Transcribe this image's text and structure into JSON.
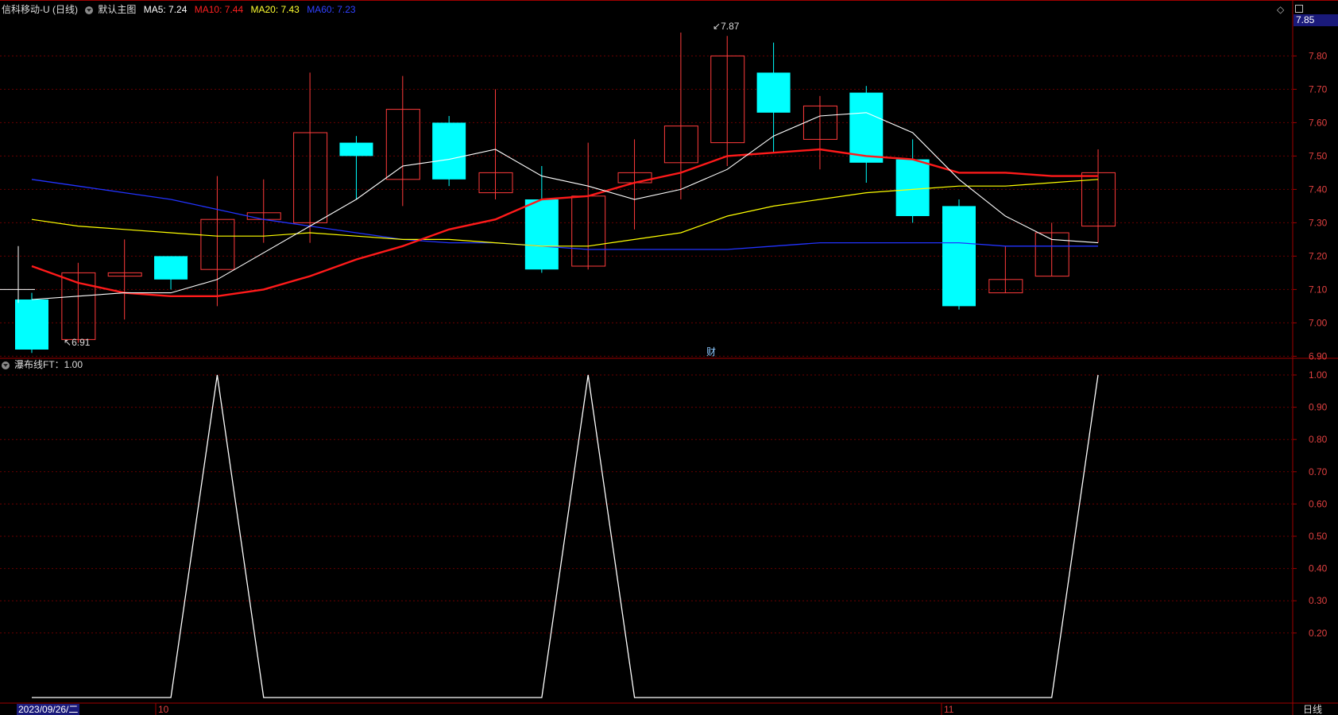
{
  "header": {
    "symbol_title": "信科移动-U (日线)",
    "template": "默认主图",
    "ma5": "MA5: 7.24",
    "ma10": "MA10: 7.44",
    "ma20": "MA20: 7.43",
    "ma60": "MA60: 7.23"
  },
  "indicator": {
    "label": "瀑布线FT：1.00"
  },
  "last_price": "7.85",
  "fin_marker": "财",
  "annotations": {
    "high": "7.87",
    "low": "6.91"
  },
  "axis": {
    "date_label": "2023/09/26/二",
    "month_labels": [
      "10",
      "11"
    ],
    "period_label": "日线",
    "price_ticks": [
      "7.80",
      "7.70",
      "7.60",
      "7.50",
      "7.40",
      "7.30",
      "7.20",
      "7.10",
      "7.00",
      "6.90"
    ],
    "indicator_ticks": [
      "1.00",
      "0.90",
      "0.80",
      "0.70",
      "0.60",
      "0.50",
      "0.40",
      "0.30",
      "0.20"
    ]
  },
  "colors": {
    "up": "#ff3b3b",
    "down": "#00ffff",
    "ma5": "#ffffff",
    "ma10": "#ff1a1a",
    "ma20": "#ffff00",
    "ma60": "#2233ff",
    "grid": "#5a0000",
    "axis_text": "#e04040"
  },
  "chart_data": {
    "type": "candlestick",
    "price_range": [
      6.88,
      7.92
    ],
    "indicator_range": [
      0,
      1.0
    ],
    "candles": [
      {
        "o": 7.07,
        "h": 7.09,
        "l": 6.91,
        "c": 6.92
      },
      {
        "o": 6.95,
        "h": 7.18,
        "l": 6.94,
        "c": 7.15
      },
      {
        "o": 7.14,
        "h": 7.25,
        "l": 7.01,
        "c": 7.15
      },
      {
        "o": 7.2,
        "h": 7.2,
        "l": 7.1,
        "c": 7.13
      },
      {
        "o": 7.16,
        "h": 7.44,
        "l": 7.05,
        "c": 7.31
      },
      {
        "o": 7.31,
        "h": 7.43,
        "l": 7.24,
        "c": 7.33
      },
      {
        "o": 7.3,
        "h": 7.75,
        "l": 7.24,
        "c": 7.57
      },
      {
        "o": 7.54,
        "h": 7.56,
        "l": 7.37,
        "c": 7.5
      },
      {
        "o": 7.43,
        "h": 7.74,
        "l": 7.35,
        "c": 7.64
      },
      {
        "o": 7.6,
        "h": 7.62,
        "l": 7.41,
        "c": 7.43
      },
      {
        "o": 7.39,
        "h": 7.7,
        "l": 7.37,
        "c": 7.45
      },
      {
        "o": 7.37,
        "h": 7.47,
        "l": 7.15,
        "c": 7.16
      },
      {
        "o": 7.17,
        "h": 7.54,
        "l": 7.16,
        "c": 7.38
      },
      {
        "o": 7.42,
        "h": 7.55,
        "l": 7.28,
        "c": 7.45
      },
      {
        "o": 7.48,
        "h": 7.87,
        "l": 7.37,
        "c": 7.59
      },
      {
        "o": 7.54,
        "h": 7.86,
        "l": 7.47,
        "c": 7.8
      },
      {
        "o": 7.75,
        "h": 7.84,
        "l": 7.51,
        "c": 7.63
      },
      {
        "o": 7.55,
        "h": 7.68,
        "l": 7.46,
        "c": 7.65
      },
      {
        "o": 7.69,
        "h": 7.71,
        "l": 7.42,
        "c": 7.48
      },
      {
        "o": 7.49,
        "h": 7.55,
        "l": 7.3,
        "c": 7.32
      },
      {
        "o": 7.35,
        "h": 7.37,
        "l": 7.04,
        "c": 7.05
      },
      {
        "o": 7.09,
        "h": 7.23,
        "l": 7.09,
        "c": 7.13
      },
      {
        "o": 7.14,
        "h": 7.3,
        "l": 7.14,
        "c": 7.27
      },
      {
        "o": 7.29,
        "h": 7.52,
        "l": 7.24,
        "c": 7.45
      }
    ],
    "ma5": [
      7.07,
      7.08,
      7.09,
      7.09,
      7.13,
      7.21,
      7.29,
      7.37,
      7.47,
      7.49,
      7.52,
      7.44,
      7.41,
      7.37,
      7.4,
      7.46,
      7.56,
      7.62,
      7.63,
      7.57,
      7.43,
      7.32,
      7.25,
      7.24
    ],
    "ma10": [
      7.17,
      7.12,
      7.09,
      7.08,
      7.08,
      7.1,
      7.14,
      7.19,
      7.23,
      7.28,
      7.31,
      7.37,
      7.38,
      7.42,
      7.45,
      7.5,
      7.51,
      7.52,
      7.5,
      7.49,
      7.45,
      7.45,
      7.44,
      7.44
    ],
    "ma20": [
      7.31,
      7.29,
      7.28,
      7.27,
      7.26,
      7.26,
      7.27,
      7.26,
      7.25,
      7.25,
      7.24,
      7.23,
      7.23,
      7.25,
      7.27,
      7.32,
      7.35,
      7.37,
      7.39,
      7.4,
      7.41,
      7.41,
      7.42,
      7.43
    ],
    "ma60": [
      7.43,
      7.41,
      7.39,
      7.37,
      7.34,
      7.31,
      7.29,
      7.27,
      7.25,
      7.24,
      7.24,
      7.23,
      7.22,
      7.22,
      7.22,
      7.22,
      7.23,
      7.24,
      7.24,
      7.24,
      7.24,
      7.23,
      7.23,
      7.23
    ],
    "indicator": [
      0,
      0,
      0,
      0,
      1,
      0,
      0,
      0,
      0,
      0,
      0,
      0,
      1,
      0,
      0,
      0,
      0,
      0,
      0,
      0,
      0,
      0,
      0,
      1
    ]
  }
}
